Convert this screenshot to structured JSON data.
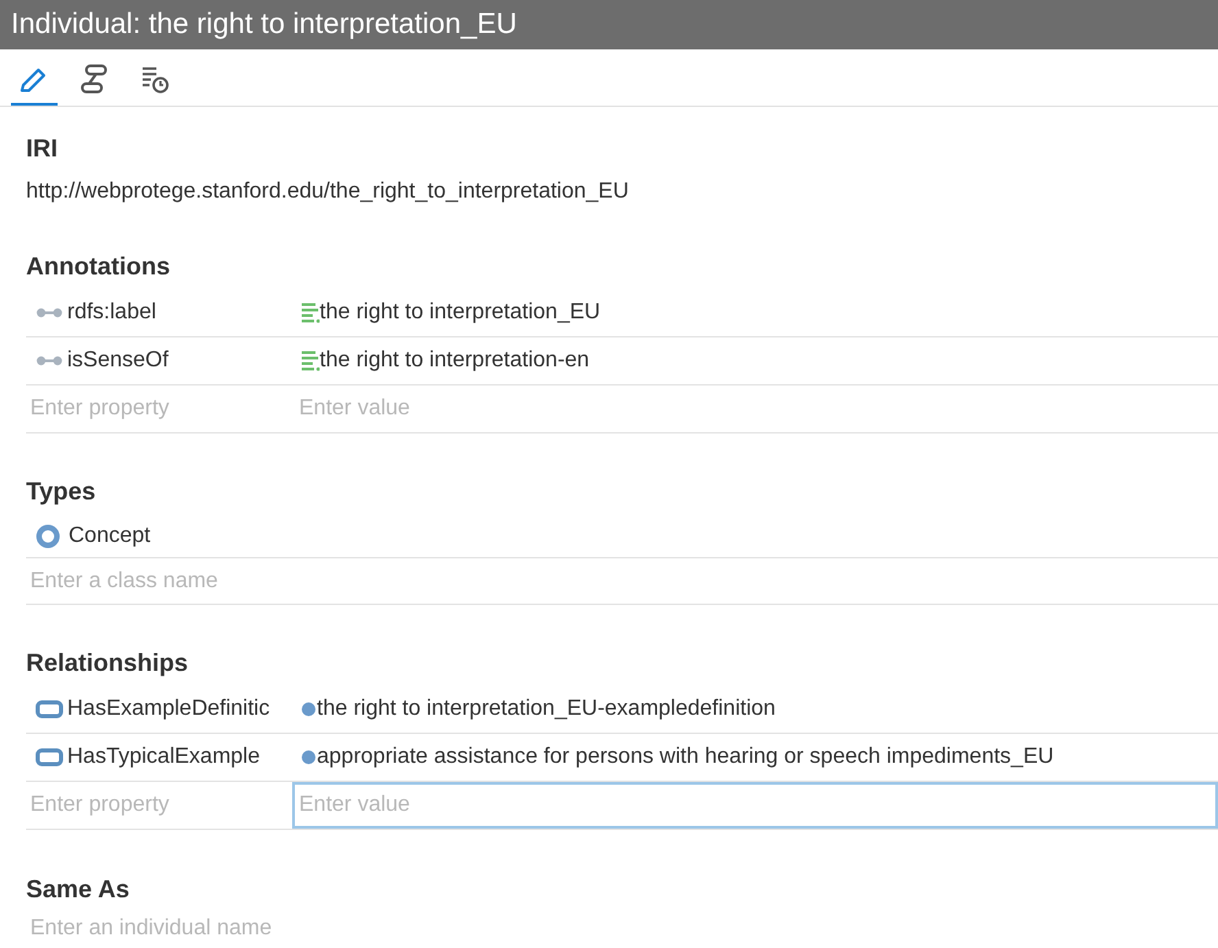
{
  "window": {
    "title": "Individual: the right to interpretation_EU"
  },
  "tabs": [
    {
      "kind": "edit",
      "selected": true
    },
    {
      "kind": "graph",
      "selected": false
    },
    {
      "kind": "history",
      "selected": false
    }
  ],
  "iri": {
    "heading": "IRI",
    "value": "http://webprotege.stanford.edu/the_right_to_interpretation_EU"
  },
  "annotations": {
    "heading": "Annotations",
    "rows": [
      {
        "property": "rdfs:label",
        "value": "the right to interpretation_EU"
      },
      {
        "property": "isSenseOf",
        "value": "the right to interpretation-en"
      }
    ],
    "property_placeholder": "Enter property",
    "value_placeholder": "Enter value",
    "value_focused": false
  },
  "types": {
    "heading": "Types",
    "items": [
      {
        "name": "Concept"
      }
    ],
    "placeholder": "Enter a class name"
  },
  "relationships": {
    "heading": "Relationships",
    "rows": [
      {
        "property": "HasExampleDefinitic",
        "value": "the right to interpretation_EU-exampledefinition"
      },
      {
        "property": "HasTypicalExample",
        "value": "appropriate assistance for persons with hearing or speech impediments_EU"
      }
    ],
    "property_placeholder": "Enter property",
    "value_placeholder": "Enter value",
    "value_focused": true
  },
  "same_as": {
    "heading": "Same As",
    "placeholder": "Enter an individual name"
  }
}
